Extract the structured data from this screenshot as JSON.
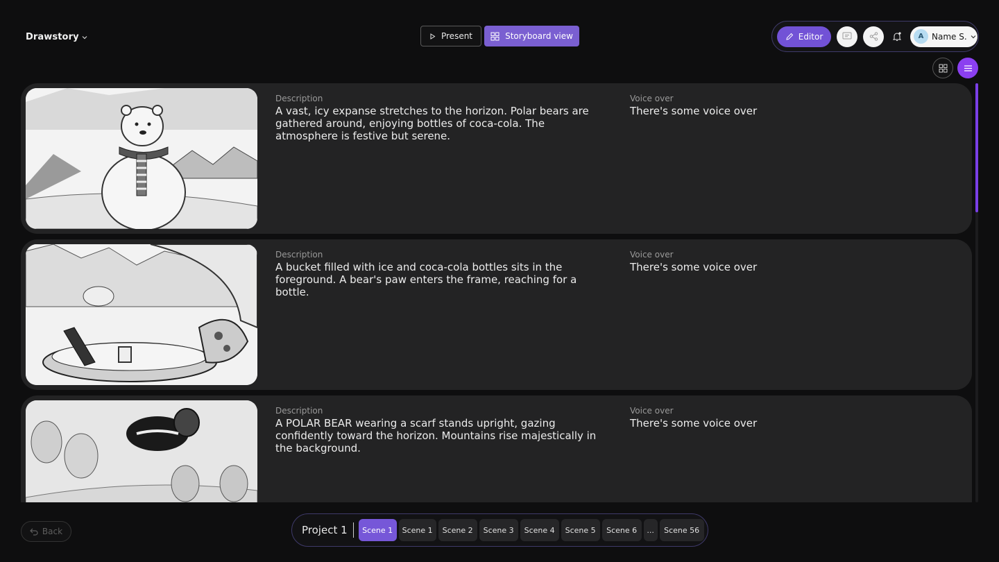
{
  "app": {
    "name": "Drawstory"
  },
  "toolbar": {
    "present_label": "Present",
    "storyboard_label": "Storyboard view",
    "editor_label": "Editor"
  },
  "user": {
    "initial": "A",
    "name": "Name S."
  },
  "scenes": [
    {
      "description_label": "Description",
      "description": "A vast, icy expanse stretches to the horizon. Polar bears are gathered around, enjoying bottles of coca-cola. The atmosphere is festive but serene.",
      "voiceover_label": "Voice over",
      "voiceover": "There's some voice over"
    },
    {
      "description_label": "Description",
      "description": "A bucket filled with ice and coca-cola bottles sits in the foreground. A bear's paw enters the frame, reaching for a bottle.",
      "voiceover_label": "Voice over",
      "voiceover": "There's some voice over"
    },
    {
      "description_label": "Description",
      "description": "A POLAR BEAR wearing a scarf stands upright, gazing confidently toward the horizon. Mountains rise majestically in the background.",
      "voiceover_label": "Voice over",
      "voiceover": "There's some voice over"
    }
  ],
  "footer": {
    "back_label": "Back",
    "project_label": "Project 1",
    "scene_tabs": [
      "Scene 1",
      "Scene 1",
      "Scene 2",
      "Scene 3",
      "Scene 4",
      "Scene 5",
      "Scene 6",
      "...",
      "Scene 56"
    ],
    "active_index": 0
  },
  "colors": {
    "accent": "#7a5fd1",
    "accent_bright": "#8b3ff0",
    "card_bg": "#232324",
    "page_bg": "#0e0e0f"
  },
  "scroll": {
    "position_fraction": 0.0
  }
}
